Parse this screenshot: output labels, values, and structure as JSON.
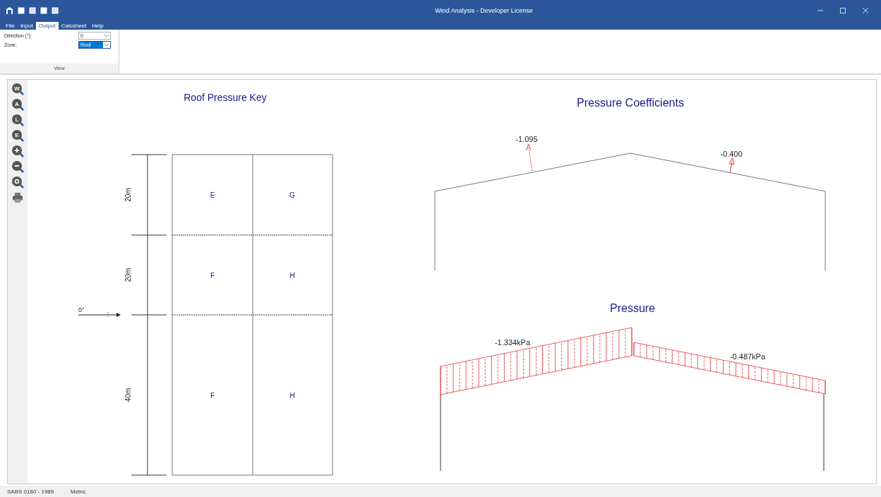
{
  "window": {
    "title": "Wind Analysis - Developer License"
  },
  "menu_tabs": [
    {
      "label": "File",
      "selected": false
    },
    {
      "label": "Input",
      "selected": false
    },
    {
      "label": "Output",
      "selected": true
    },
    {
      "label": "Calcsheet",
      "selected": false
    },
    {
      "label": "Help",
      "selected": false
    }
  ],
  "ribbon": {
    "fields": [
      {
        "label": "Direction (°):",
        "value": "0",
        "focused": false
      },
      {
        "label": "Zone:",
        "value": "Roof",
        "focused": true
      }
    ],
    "group_label": "View"
  },
  "toolbar": [
    {
      "kind": "zoom",
      "letter": "W"
    },
    {
      "kind": "zoom",
      "letter": "A"
    },
    {
      "kind": "zoom",
      "letter": "L"
    },
    {
      "kind": "zoom",
      "letter": "E"
    },
    {
      "kind": "zoom-in"
    },
    {
      "kind": "zoom-out"
    },
    {
      "kind": "zoom-fit"
    },
    {
      "kind": "print"
    }
  ],
  "key": {
    "title": "Roof Pressure Key",
    "direction_label": "0°",
    "rows": [
      {
        "dimension": "20m",
        "zones": [
          "E",
          "G"
        ]
      },
      {
        "dimension": "20m",
        "zones": [
          "F",
          "H"
        ]
      },
      {
        "dimension": "40m",
        "zones": [
          "F",
          "H"
        ]
      }
    ]
  },
  "coefficients": {
    "title": "Pressure Coefficients",
    "values": [
      "-1.095",
      "-0.400"
    ]
  },
  "pressure": {
    "title": "Pressure",
    "values": [
      "-1.334kPa",
      "-0.487kPa"
    ]
  },
  "status_bar": [
    "SABS 0160 - 1989",
    "Metric"
  ]
}
